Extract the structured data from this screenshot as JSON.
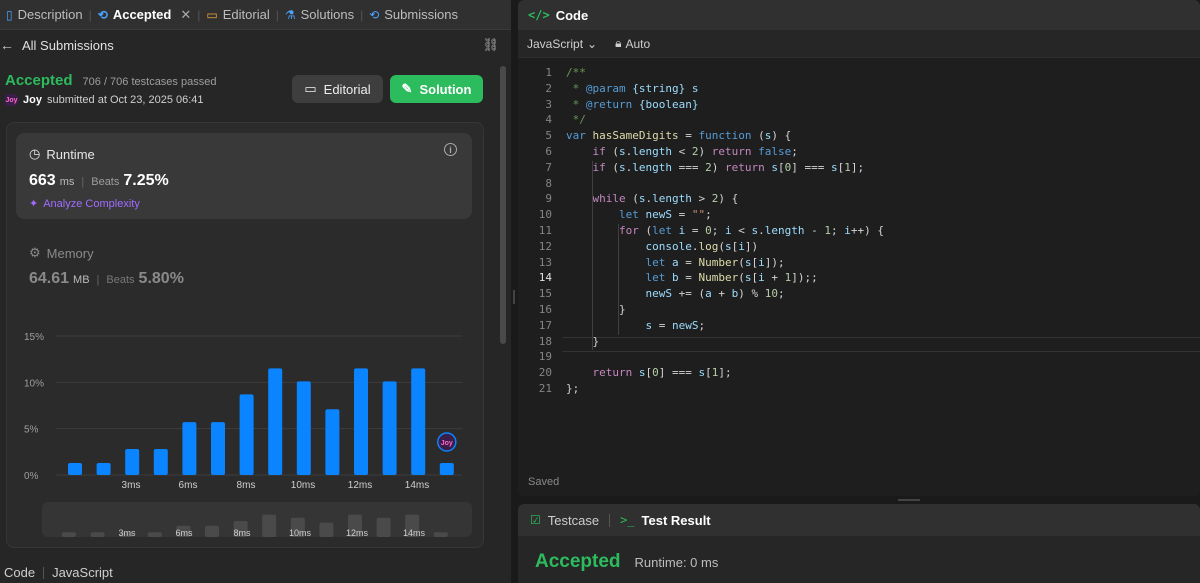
{
  "tabs": [
    {
      "label": "Description",
      "icon": "description-icon"
    },
    {
      "label": "Accepted",
      "icon": "history-icon",
      "active": true
    },
    {
      "label": "Editorial",
      "icon": "book-icon"
    },
    {
      "label": "Solutions",
      "icon": "flask-icon"
    },
    {
      "label": "Submissions",
      "icon": "history-icon"
    }
  ],
  "all_submissions": "All Submissions",
  "submission": {
    "status": "Accepted",
    "testcases": "706 / 706 testcases passed",
    "user": "Joy",
    "submitted_text": "submitted at Oct 23, 2025 06:41",
    "editorial_btn": "Editorial",
    "solution_btn": "Solution"
  },
  "runtime": {
    "title": "Runtime",
    "value": "663",
    "unit": "ms",
    "beats_label": "Beats",
    "beats": "7.25%",
    "analyze": "Analyze Complexity"
  },
  "memory": {
    "title": "Memory",
    "value": "64.61",
    "unit": "MB",
    "beats_label": "Beats",
    "beats": "5.80%"
  },
  "chart_data": {
    "type": "bar",
    "title": "",
    "xlabel": "",
    "ylabel": "",
    "ylim": [
      0,
      15
    ],
    "yticks": [
      "15%",
      "10%",
      "5%",
      "0%"
    ],
    "xtick_labels": [
      "3ms",
      "6ms",
      "8ms",
      "10ms",
      "12ms",
      "14ms"
    ],
    "values": [
      1.3,
      1.3,
      2.8,
      2.8,
      5.7,
      5.7,
      8.7,
      11.5,
      10.1,
      7.1,
      11.5,
      10.1,
      11.5,
      1.3
    ],
    "nav_values": [
      0.3,
      0.3,
      0.3,
      0.3,
      0.7,
      0.7,
      1.0,
      1.4,
      1.2,
      0.9,
      1.4,
      1.2,
      1.4,
      0.3
    ],
    "marker_label": "Joy",
    "bar_color": "#0a84ff",
    "nav_color": "#4a4a4a"
  },
  "bottom": {
    "code_label": "Code",
    "lang": "JavaScript"
  },
  "code_panel": {
    "title": "Code",
    "language": "JavaScript",
    "mode": "Auto",
    "saved": "Saved"
  },
  "code_lines": [
    {
      "n": "1",
      "html": "<span class=\"cm\">/**</span>"
    },
    {
      "n": "2",
      "html": "<span class=\"cm\"> * </span><span class=\"cmt\">@param</span><span class=\"cm\"> </span><span class=\"var\">{string}</span><span class=\"cm\"> </span><span class=\"var\">s</span>"
    },
    {
      "n": "3",
      "html": "<span class=\"cm\"> * </span><span class=\"cmt\">@return</span><span class=\"cm\"> </span><span class=\"var\">{boolean}</span>"
    },
    {
      "n": "4",
      "html": "<span class=\"cm\"> */</span>"
    },
    {
      "n": "5",
      "html": "<span class=\"kw\">var</span> <span class=\"fn\">hasSameDigits</span> = <span class=\"kw\">function</span> (<span class=\"var\">s</span>) {"
    },
    {
      "n": "6",
      "html": "    <span class=\"ctl\">if</span> (<span class=\"var\">s</span>.<span class=\"var\">length</span> &lt; <span class=\"num\">2</span>) <span class=\"ctl\">return</span> <span class=\"kw\">false</span>;"
    },
    {
      "n": "7",
      "html": "    <span class=\"ctl\">if</span> (<span class=\"var\">s</span>.<span class=\"var\">length</span> === <span class=\"num\">2</span>) <span class=\"ctl\">return</span> <span class=\"var\">s</span>[<span class=\"num\">0</span>] === <span class=\"var\">s</span>[<span class=\"num\">1</span>];"
    },
    {
      "n": "8",
      "html": ""
    },
    {
      "n": "9",
      "html": "    <span class=\"ctl\">while</span> (<span class=\"var\">s</span>.<span class=\"var\">length</span> &gt; <span class=\"num\">2</span>) {"
    },
    {
      "n": "10",
      "html": "        <span class=\"kw\">let</span> <span class=\"var\">newS</span> = <span class=\"str\">\"\"</span>;"
    },
    {
      "n": "11",
      "html": "        <span class=\"ctl\">for</span> (<span class=\"kw\">let</span> <span class=\"var\">i</span> = <span class=\"num\">0</span>; <span class=\"var\">i</span> &lt; <span class=\"var\">s</span>.<span class=\"var\">length</span> - <span class=\"num\">1</span>; <span class=\"var\">i</span>++) {"
    },
    {
      "n": "12",
      "html": "            <span class=\"var\">console</span>.<span class=\"fn\">log</span>(<span class=\"var\">s</span>[<span class=\"var\">i</span>])"
    },
    {
      "n": "13",
      "html": "            <span class=\"kw\">let</span> <span class=\"var\">a</span> = <span class=\"fn\">Number</span>(<span class=\"var\">s</span>[<span class=\"var\">i</span>]);"
    },
    {
      "n": "14",
      "html": "            <span class=\"kw\">let</span> <span class=\"var\">b</span> = <span class=\"fn\">Number</span>(<span class=\"var\">s</span>[<span class=\"var\">i</span> + <span class=\"num\">1</span>]);;"
    },
    {
      "n": "15",
      "html": "            <span class=\"var\">newS</span> += (<span class=\"var\">a</span> + <span class=\"var\">b</span>) % <span class=\"num\">10</span>;"
    },
    {
      "n": "16",
      "html": "        }"
    },
    {
      "n": "17",
      "html": "            <span class=\"var\">s</span> = <span class=\"var\">newS</span>;"
    },
    {
      "n": "18",
      "html": "    }"
    },
    {
      "n": "19",
      "html": ""
    },
    {
      "n": "20",
      "html": "    <span class=\"ctl\">return</span> <span class=\"var\">s</span>[<span class=\"num\">0</span>] === <span class=\"var\">s</span>[<span class=\"num\">1</span>];"
    },
    {
      "n": "21",
      "html": "};"
    }
  ],
  "result_panel": {
    "testcase_tab": "Testcase",
    "test_result_tab": "Test Result",
    "status": "Accepted",
    "runtime": "Runtime: 0 ms"
  }
}
